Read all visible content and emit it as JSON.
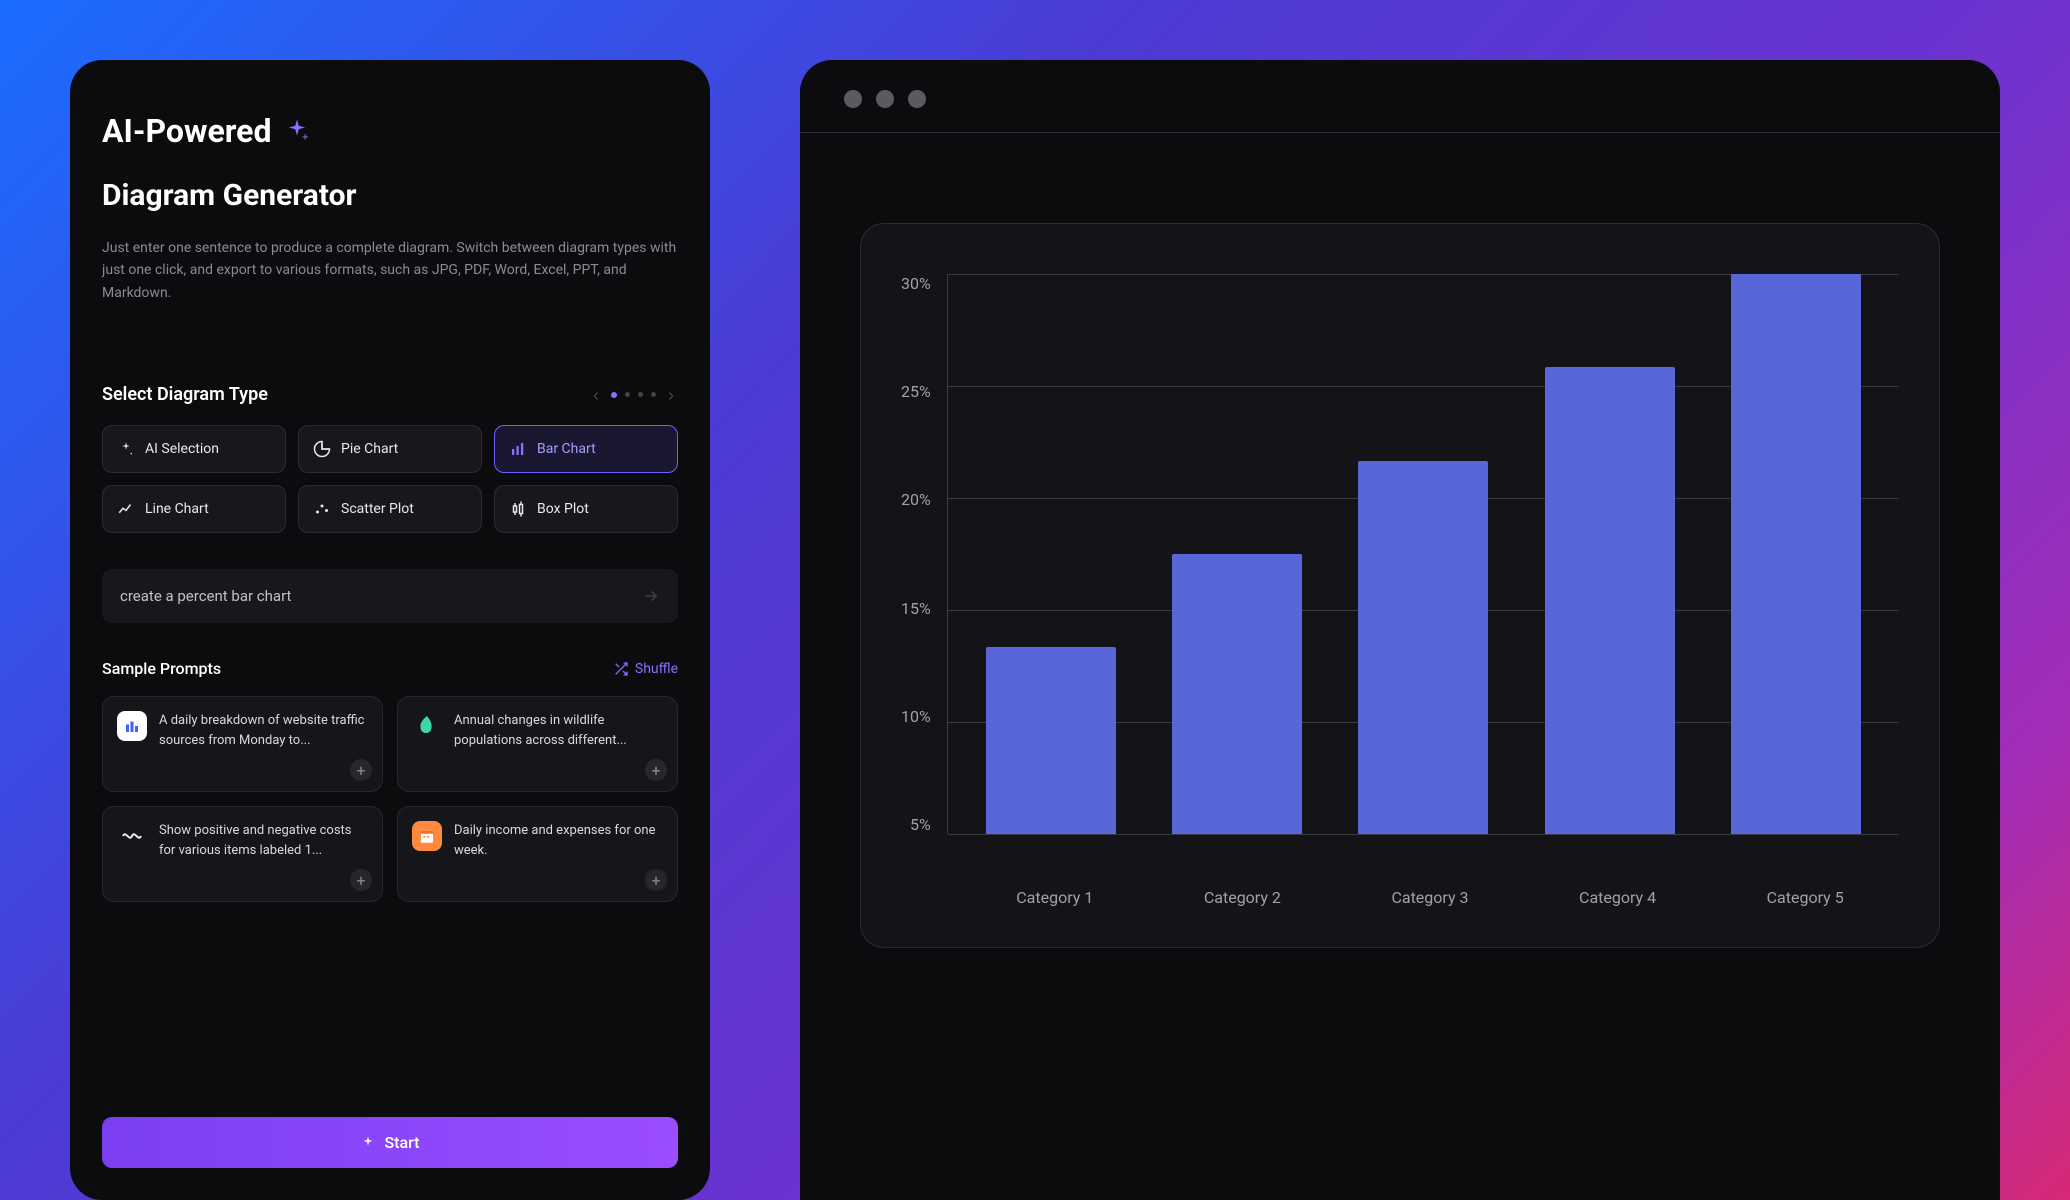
{
  "left": {
    "title_prefix": "AI-Powered",
    "subtitle": "Diagram Generator",
    "description": "Just enter one sentence to produce a complete diagram. Switch between diagram types with just one click, and export to various formats, such as JPG, PDF, Word, Excel, PPT, and Markdown.",
    "section_title": "Select Diagram Type",
    "chips": [
      {
        "label": "AI Selection",
        "selected": false,
        "icon": "sparkle"
      },
      {
        "label": "Pie Chart",
        "selected": false,
        "icon": "pie"
      },
      {
        "label": "Bar Chart",
        "selected": true,
        "icon": "bar"
      },
      {
        "label": "Line Chart",
        "selected": false,
        "icon": "line"
      },
      {
        "label": "Scatter Plot",
        "selected": false,
        "icon": "scatter"
      },
      {
        "label": "Box Plot",
        "selected": false,
        "icon": "box"
      }
    ],
    "prompt_value": "create a percent bar chart",
    "sample_title": "Sample Prompts",
    "shuffle_label": "Shuffle",
    "samples": [
      {
        "text": "A daily breakdown of website traffic sources from Monday to...",
        "icon_bg": "#ffffff",
        "icon": "bars-blue"
      },
      {
        "text": "Annual changes in wildlife populations across different...",
        "icon_bg": "transparent",
        "icon": "leaf"
      },
      {
        "text": "Show positive and negative costs for various items labeled 1...",
        "icon_bg": "transparent",
        "icon": "wave"
      },
      {
        "text": "Daily income and expenses for one week.",
        "icon_bg": "#ff8a3d",
        "icon": "calendar"
      }
    ],
    "start_label": "Start"
  },
  "chart_data": {
    "type": "bar",
    "categories": [
      "Category 1",
      "Category 2",
      "Category 3",
      "Category 4",
      "Category 5"
    ],
    "values": [
      10,
      15,
      20,
      25,
      30
    ],
    "ylabel": "",
    "xlabel": "",
    "ylim": [
      0,
      30
    ],
    "yticks": [
      "30%",
      "25%",
      "20%",
      "15%",
      "10%",
      "5%"
    ],
    "bar_color": "#5966d9"
  }
}
